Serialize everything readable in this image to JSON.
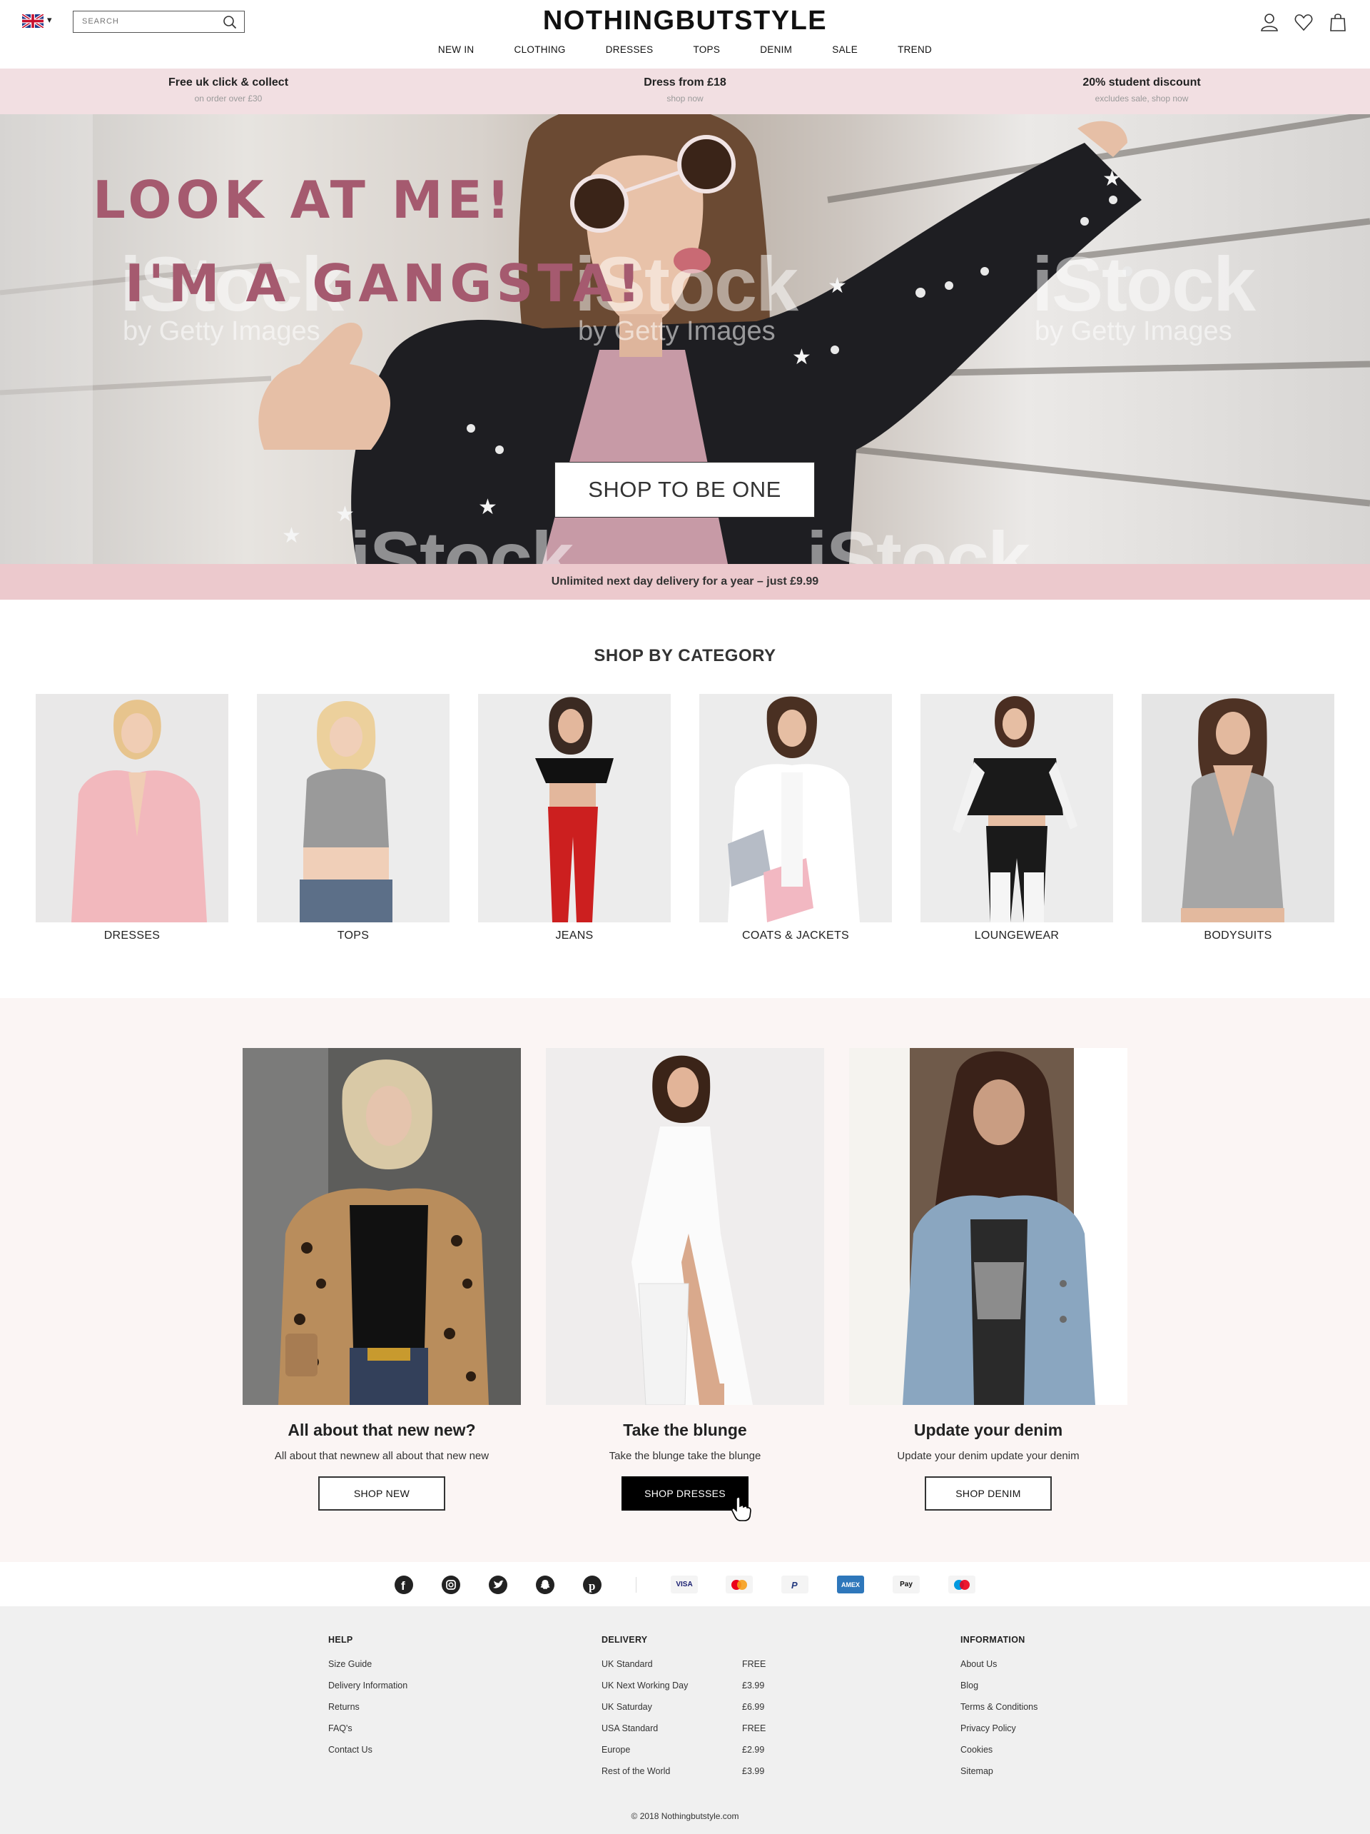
{
  "header": {
    "brand": "NOTHINGBUTSTYLE",
    "search_placeholder": "SEARCH",
    "nav": [
      "NEW IN",
      "CLOTHING",
      "DRESSES",
      "TOPS",
      "DENIM",
      "SALE",
      "TREND"
    ],
    "icons": [
      "flag-uk-icon",
      "search-icon",
      "account-icon",
      "heart-icon",
      "bag-icon"
    ]
  },
  "promos": [
    {
      "title": "Free uk click & collect",
      "sub": "on order over £30"
    },
    {
      "title": "Dress from £18",
      "sub": "shop now"
    },
    {
      "title": "20% student discount",
      "sub": "excludes sale, shop now"
    }
  ],
  "hero": {
    "line1": "LOOK AT ME!",
    "line2": "I'M A GANGSTA!",
    "watermark": "iStock",
    "watermark_sub": "by Getty Images",
    "cta": "SHOP TO BE ONE"
  },
  "delivery_banner": "Unlimited next day delivery for a year – just £9.99",
  "categories": {
    "heading": "SHOP BY CATEGORY",
    "items": [
      "DRESSES",
      "TOPS",
      "JEANS",
      "COATS & JACKETS",
      "LOUNGEWEAR",
      "BODYSUITS"
    ]
  },
  "features": [
    {
      "title": "All about that new new?",
      "desc": "All about that newnew all about that new new",
      "cta": "SHOP NEW"
    },
    {
      "title": "Take the blunge",
      "desc": "Take the blunge take the blunge",
      "cta": "SHOP DRESSES"
    },
    {
      "title": "Update your denim",
      "desc": "Update your denim update your denim",
      "cta": "SHOP DENIM"
    }
  ],
  "social": [
    "facebook-icon",
    "instagram-icon",
    "twitter-icon",
    "snapchat-icon",
    "pinterest-icon"
  ],
  "payments": [
    "VISA",
    "mastercard",
    "paypal",
    "AMEX",
    "Pay",
    "maestro"
  ],
  "footer": {
    "help": {
      "heading": "HELP",
      "items": [
        "Size Guide",
        "Delivery Information",
        "Returns",
        "FAQ's",
        "Contact Us"
      ]
    },
    "delivery": {
      "heading": "DELIVERY",
      "rows": [
        {
          "name": "UK Standard",
          "price": "FREE"
        },
        {
          "name": "UK Next Working Day",
          "price": "£3.99"
        },
        {
          "name": "UK Saturday",
          "price": "£6.99"
        },
        {
          "name": "USA Standard",
          "price": "FREE"
        },
        {
          "name": "Europe",
          "price": "£2.99"
        },
        {
          "name": "Rest of the World",
          "price": "£3.99"
        }
      ]
    },
    "information": {
      "heading": "INFORMATION",
      "items": [
        "About Us",
        "Blog",
        "Terms & Conditions",
        "Privacy Policy",
        "Cookies",
        "Sitemap"
      ]
    },
    "copyright": "© 2018 Nothingbutstyle.com"
  },
  "colors": {
    "promo_bg": "#f2dfe2",
    "banner_bg": "#ecc9cd",
    "accent_text": "#a55a6f",
    "feature_bg": "#fbf5f4",
    "footer_bg": "#f0f0f0"
  }
}
